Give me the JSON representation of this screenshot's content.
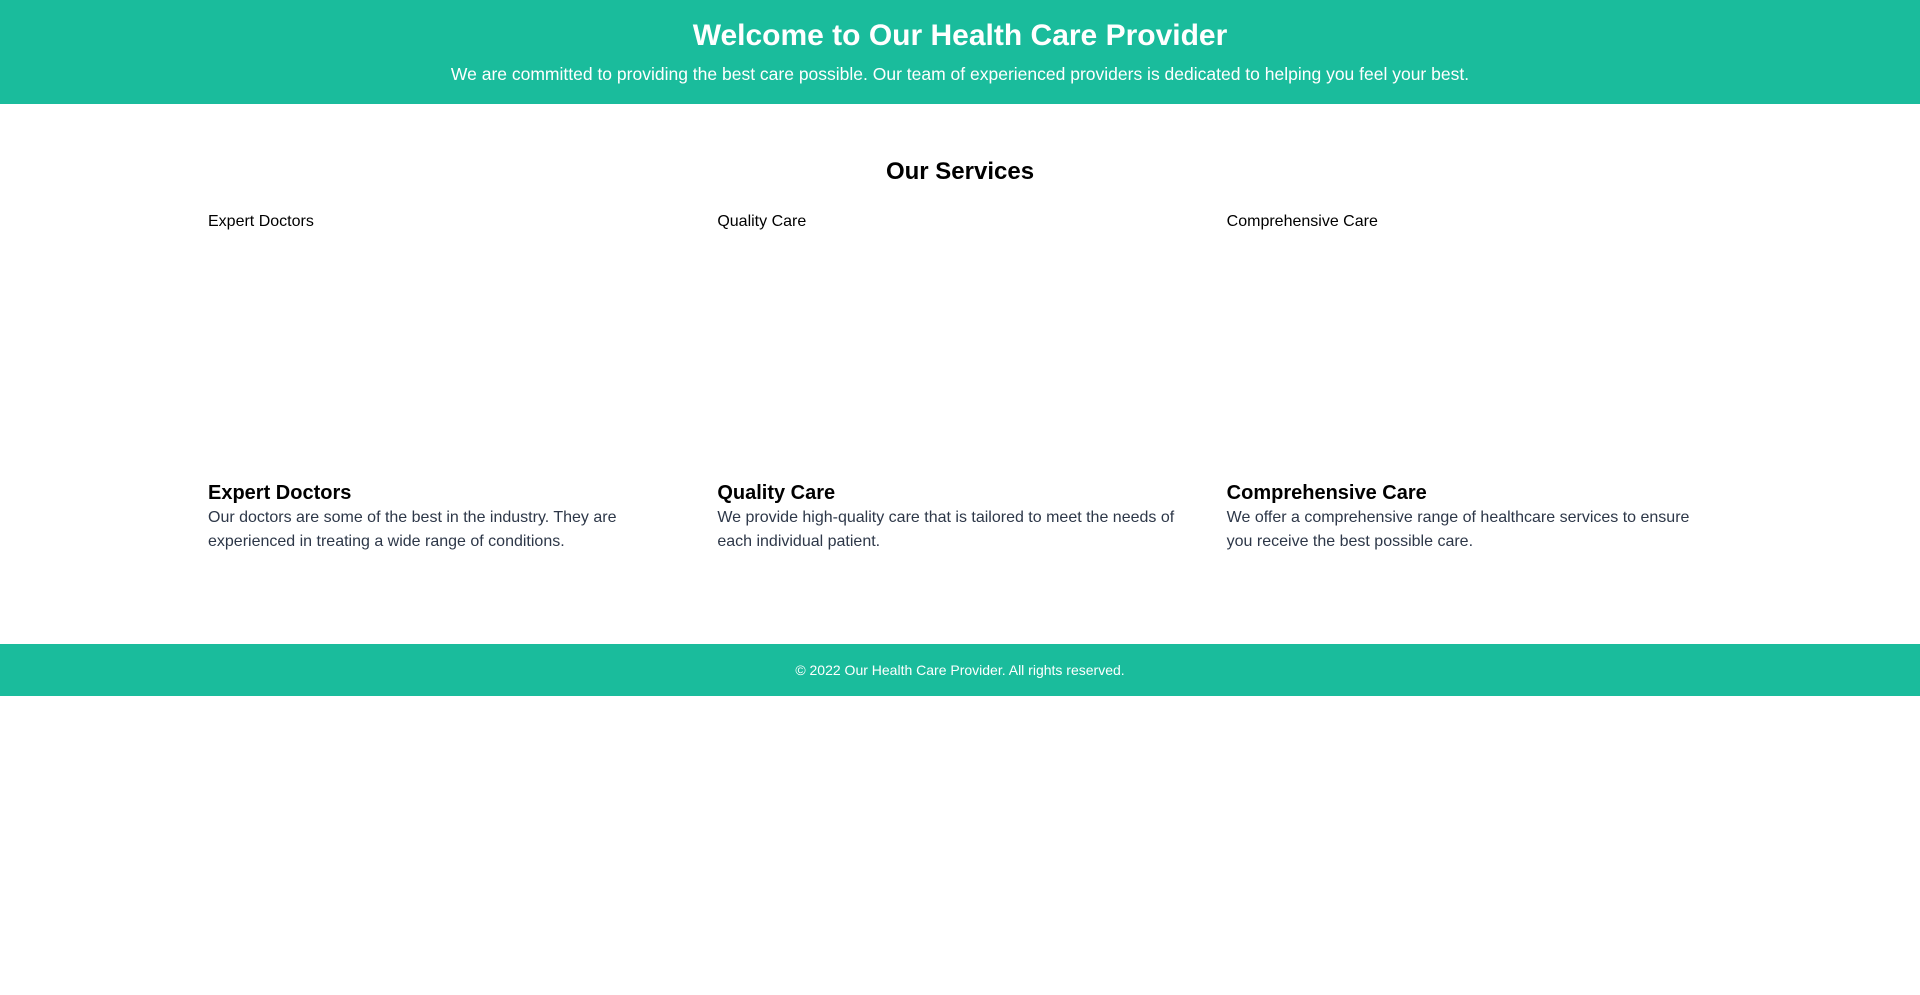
{
  "hero": {
    "title": "Welcome to Our Health Care Provider",
    "subtitle": "We are committed to providing the best care possible. Our team of experienced providers is dedicated to helping you feel your best."
  },
  "services": {
    "heading": "Our Services",
    "items": [
      {
        "image_alt": "Expert Doctors",
        "title": "Expert Doctors",
        "description": "Our doctors are some of the best in the industry. They are experienced in treating a wide range of conditions."
      },
      {
        "image_alt": "Quality Care",
        "title": "Quality Care",
        "description": "We provide high-quality care that is tailored to meet the needs of each individual patient."
      },
      {
        "image_alt": "Comprehensive Care",
        "title": "Comprehensive Care",
        "description": "We offer a comprehensive range of healthcare services to ensure you receive the best possible care."
      }
    ]
  },
  "footer": {
    "copyright": "© 2022 Our Health Care Provider. All rights reserved."
  },
  "colors": {
    "brand": "#1abc9c",
    "text": "#000000",
    "body_text": "#2d3748"
  }
}
